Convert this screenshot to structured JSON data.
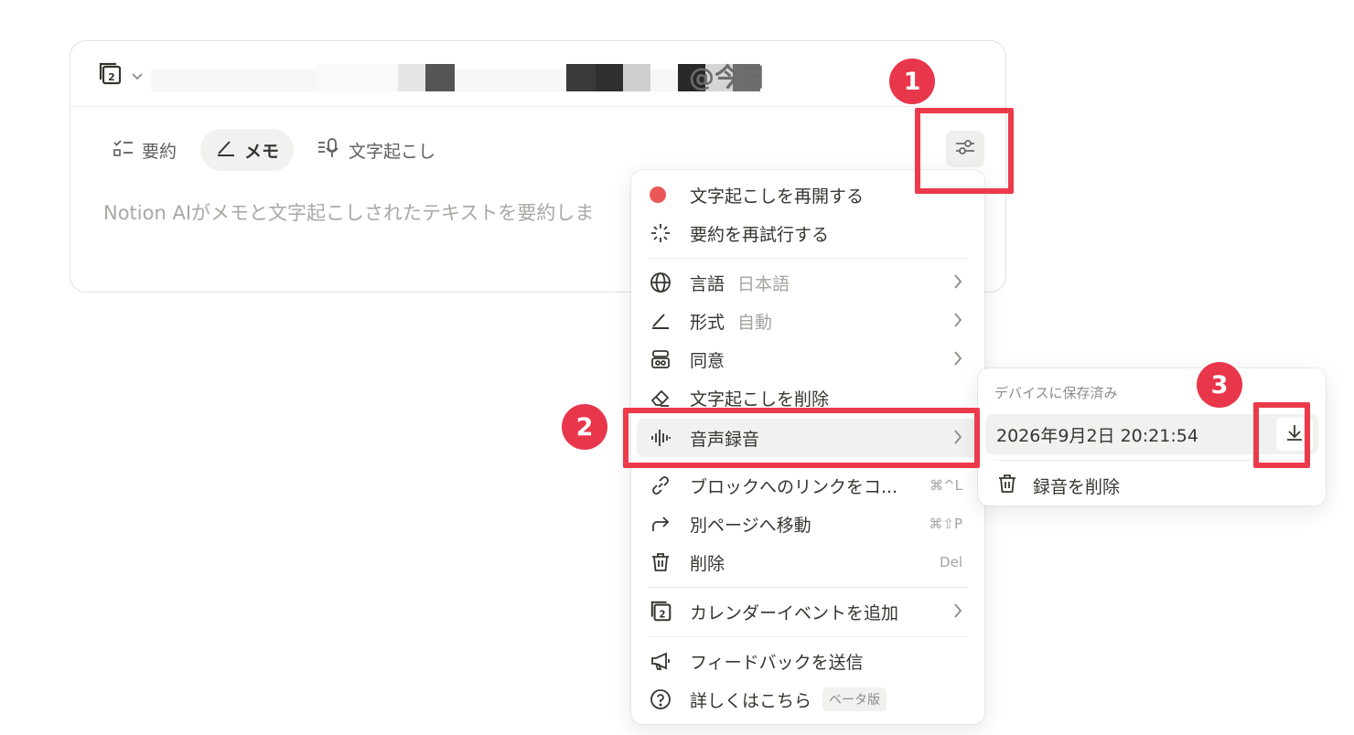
{
  "card": {
    "title_suffix": "@今日",
    "calendar_day": "2",
    "tabs": [
      {
        "label": "要約",
        "icon": "checklist-icon",
        "active": false
      },
      {
        "label": "メモ",
        "icon": "pen-icon",
        "active": true
      },
      {
        "label": "文字起こし",
        "icon": "transcript-mic-icon",
        "active": false
      }
    ],
    "placeholder": "Notion AIがメモと文字起こしされたテキストを要約しま"
  },
  "menu": {
    "resume_transcription": "文字起こしを再開する",
    "retry_summary": "要約を再試行する",
    "language": {
      "label": "言語",
      "value": "日本語"
    },
    "format": {
      "label": "形式",
      "value": "自動"
    },
    "consent": "同意",
    "delete_transcription": "文字起こしを削除",
    "audio_recording": "音声録音",
    "copy_link": {
      "label": "ブロックへのリンクをコ...",
      "shortcut": "⌘^L"
    },
    "move_to": {
      "label": "別ページへ移動",
      "shortcut": "⌘⇧P"
    },
    "delete": {
      "label": "削除",
      "shortcut": "Del"
    },
    "add_calendar_event": "カレンダーイベントを追加",
    "send_feedback": "フィードバックを送信",
    "learn_more": {
      "label": "詳しくはこちら",
      "badge": "ベータ版"
    }
  },
  "submenu": {
    "title": "デバイスに保存済み",
    "recording_timestamp": "2026年9月2日 20:21:54",
    "delete_recording": "録音を削除"
  },
  "annotations": {
    "one": "1",
    "two": "2",
    "three": "3",
    "color": "#ec3a4b"
  }
}
